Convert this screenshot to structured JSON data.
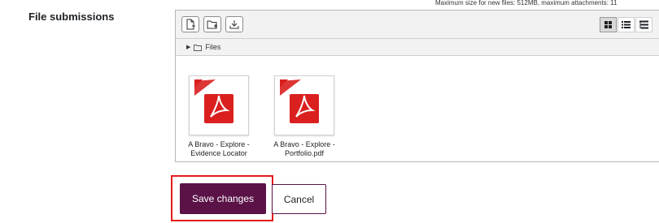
{
  "field": {
    "label": "File submissions"
  },
  "limits": {
    "text": "Maximum size for new files: 512MB, maximum attachments: 11"
  },
  "toolbar": {
    "left_icons": [
      "add-file-icon",
      "create-folder-icon",
      "download-icon"
    ],
    "view_icons": [
      "grid-view-icon",
      "list-view-icon",
      "tree-view-icon"
    ],
    "active_view": "grid-view-icon"
  },
  "path": {
    "label": "Files"
  },
  "files": [
    {
      "name_line1": "A Bravo - Explore -",
      "name_line2": "Evidence Locator",
      "icon": "pdf-file-icon"
    },
    {
      "name_line1": "A Bravo - Explore -",
      "name_line2": "Portfolio.pdf",
      "icon": "pdf-file-icon"
    }
  ],
  "actions": {
    "save_label": "Save changes",
    "cancel_label": "Cancel"
  },
  "colors": {
    "primary": "#5a1247",
    "highlight": "#e41b1b",
    "pdf": "#d9201f"
  }
}
